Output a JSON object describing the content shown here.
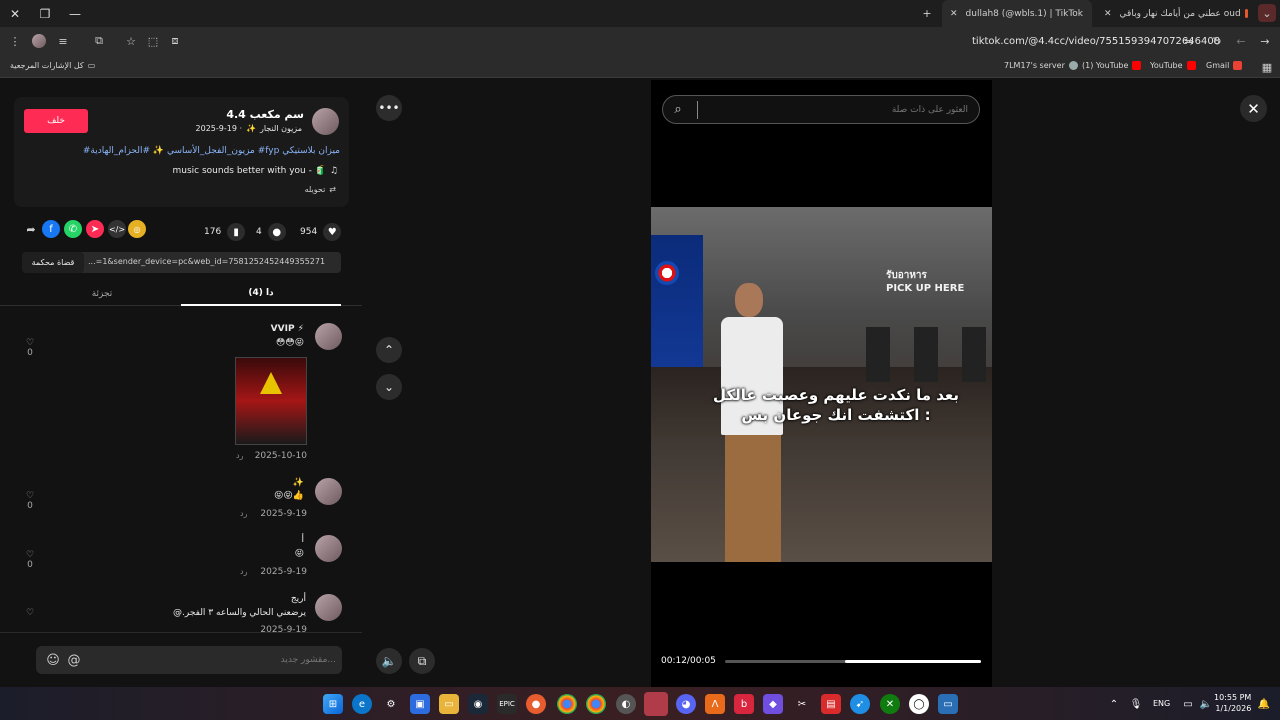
{
  "browser": {
    "tabs": [
      {
        "title": "عطني من أيامك نهار وباقي oud"
      },
      {
        "title": "dullah8 (@wbls.1) | TikTok"
      }
    ],
    "url": "tiktok.com/@4.4cc/video/7551593947072646408",
    "bookmarks": [
      {
        "label": "كل الإشارات المرجعية"
      },
      {
        "label": "7LM17's server"
      },
      {
        "label": "(1) YouTube"
      },
      {
        "label": "YouTube"
      },
      {
        "label": "Gmail"
      }
    ]
  },
  "post": {
    "author_name": "4.4 سم مكعب",
    "author_handle": "مزيون النجار",
    "date": "2025-9-19 ·",
    "follow_label": "خلف",
    "caption": "#مزيون_الفجل_الأساسي ✨ #الحزام_الهادية #fyp ميزان بلاستيكي",
    "music": "music sounds better with you - 🧃",
    "translate_label": "تحويله",
    "likes": "954",
    "comments": "4",
    "saves": "176",
    "link_text": "...=1&sender_device=pc&web_id=7581252452449355271",
    "copy_link_label": "قضاة محكمة"
  },
  "comment_tabs": [
    {
      "label": "(4) دا"
    },
    {
      "label": "تجزئة"
    }
  ],
  "comments": [
    {
      "author": "VVIP ⚡",
      "text": "😳😳😝",
      "date": "2025-10-10",
      "reply": "رد",
      "likes": "0"
    },
    {
      "author": "✨",
      "text": "😝😝👍",
      "date": "2025-9-19",
      "reply": "رد",
      "likes": "0"
    },
    {
      "author": "أ",
      "text": "😝",
      "date": "2025-9-19",
      "reply": "رد",
      "likes": "0"
    },
    {
      "author": "أريج",
      "text": "@.يرضعني الحالي والساعه ٣ الفجر",
      "date": "2025-9-19",
      "reply": "رد",
      "likes": "0"
    }
  ],
  "comment_input": {
    "placeholder": "مقشور جديد..."
  },
  "video": {
    "search_placeholder": "العثور على ذات صلة",
    "caption_line1": "بعد ما نكدت عليهم وعصبت عالكل",
    "caption_line2": "اكتشفت انك جوعان بس :",
    "sign_thai": "รับอาหาร",
    "sign_en": "PICK UP HERE",
    "time": "00:12/00:05",
    "progress": 0.53
  },
  "taskbar": {
    "lang": "ENG",
    "time": "10:55 PM",
    "date": "1/1/2026"
  }
}
